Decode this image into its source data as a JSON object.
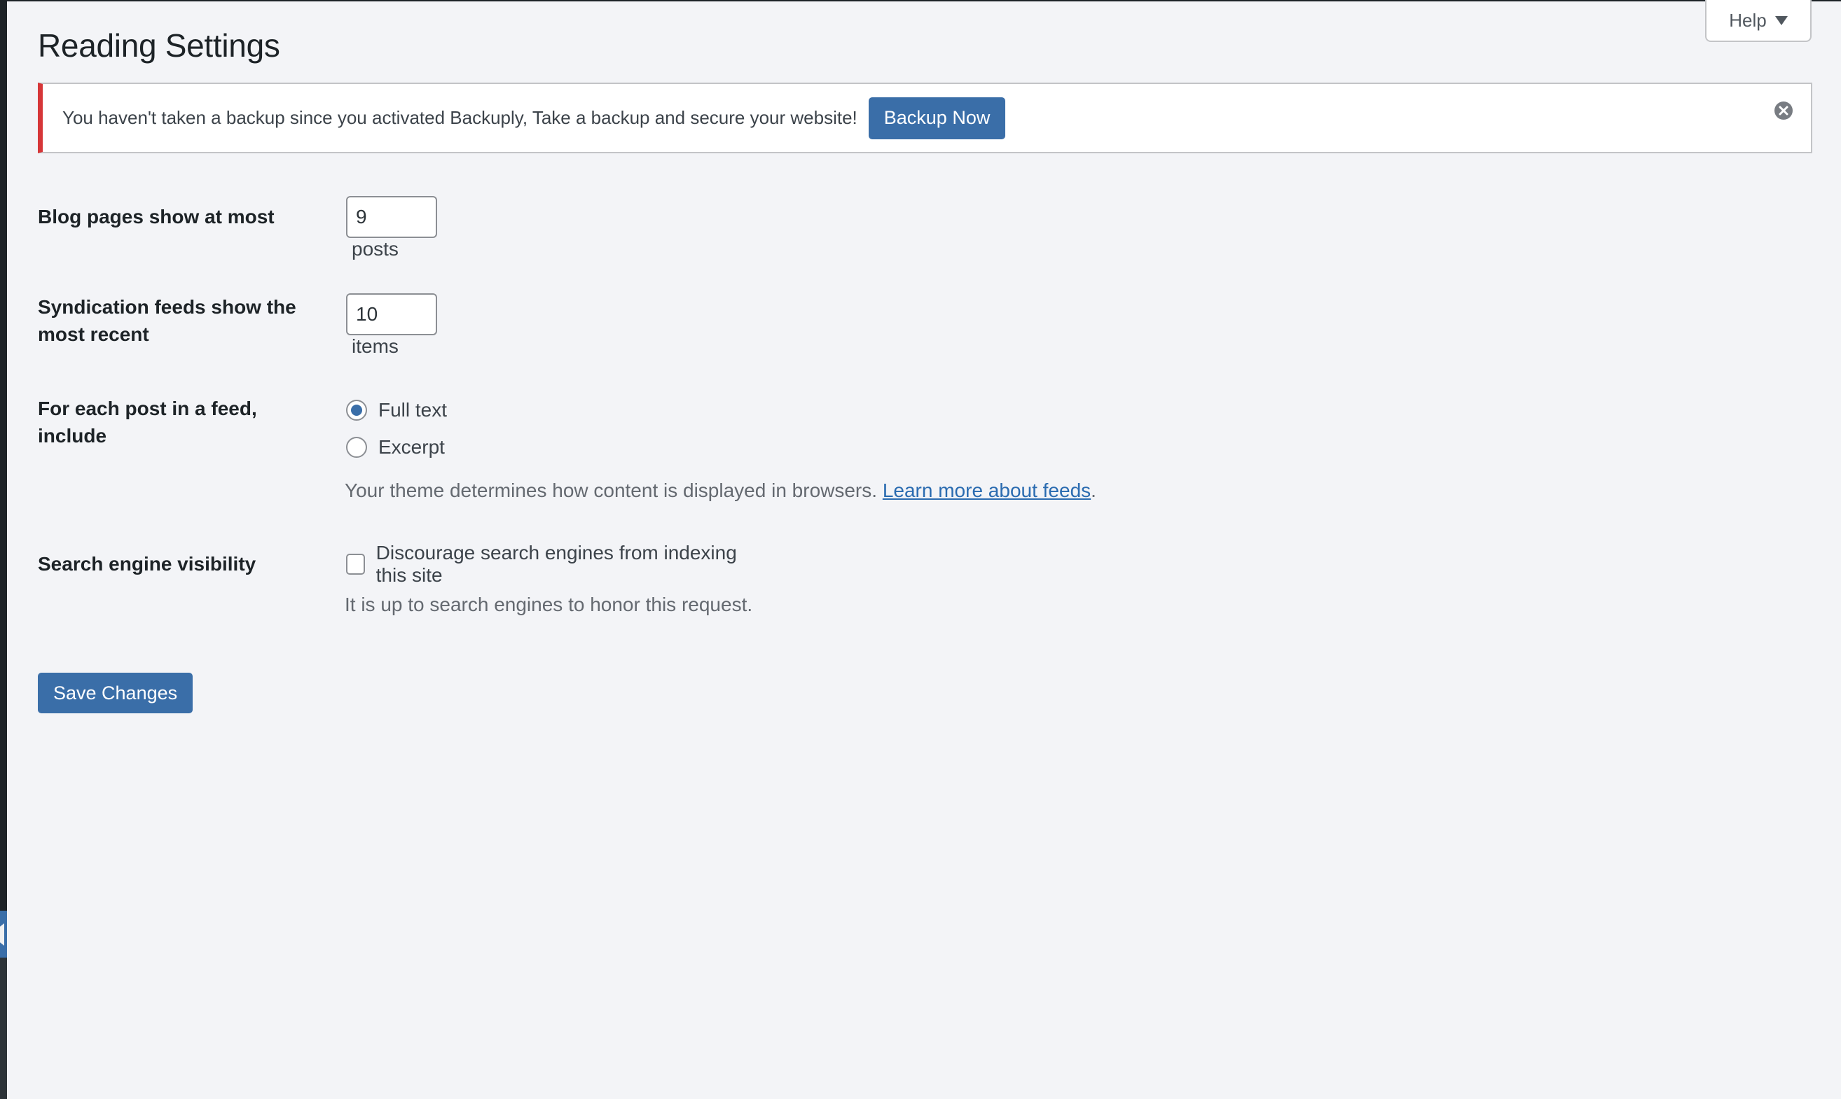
{
  "page": {
    "title": "Reading Settings",
    "help_label": "Help"
  },
  "notice": {
    "message": "You haven't taken a backup since you activated Backuply, Take a backup and secure your website!",
    "button_label": "Backup Now",
    "accent_color": "#d63638"
  },
  "settings": {
    "blog_pages": {
      "label": "Blog pages show at most",
      "value": "9",
      "suffix": "posts"
    },
    "syndication": {
      "label": "Syndication feeds show the most recent",
      "value": "10",
      "suffix": "items"
    },
    "feed_content": {
      "label": "For each post in a feed, include",
      "options": [
        {
          "label": "Full text",
          "selected": true
        },
        {
          "label": "Excerpt",
          "selected": false
        }
      ],
      "description": "Your theme determines how content is displayed in browsers.",
      "link_text": "Learn more about feeds",
      "link_trail": "."
    },
    "search_visibility": {
      "label": "Search engine visibility",
      "checkbox_label": "Discourage search engines from indexing this site",
      "checked": false,
      "description": "It is up to search engines to honor this request."
    }
  },
  "actions": {
    "save_label": "Save Changes",
    "primary_color": "#3a6ea8"
  }
}
